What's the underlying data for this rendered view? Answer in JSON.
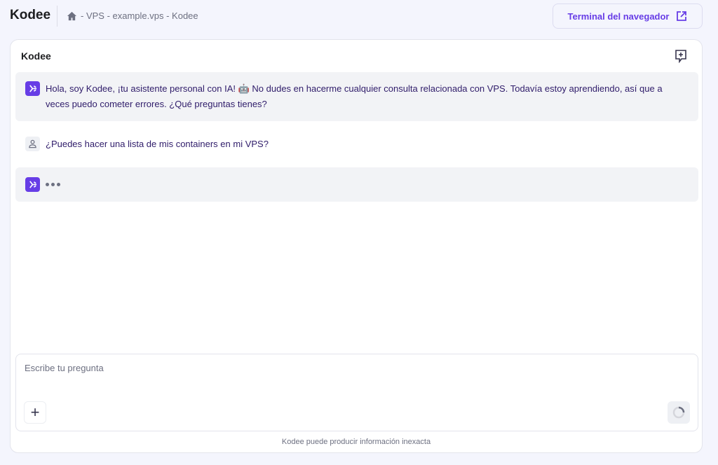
{
  "header": {
    "title": "Kodee",
    "breadcrumb": "- VPS - example.vps - Kodee",
    "terminal_button": "Terminal del navegador"
  },
  "chat": {
    "title": "Kodee",
    "messages": [
      {
        "role": "bot",
        "text": "Hola, soy Kodee, ¡tu asistente personal con IA! 🤖 No dudes en hacerme cualquier consulta relacionada con VPS. Todavía estoy aprendiendo, así que a veces puedo cometer errores. ¿Qué preguntas tienes?"
      },
      {
        "role": "user",
        "text": "¿Puedes hacer una lista de mis containers en mi VPS?"
      }
    ],
    "input_placeholder": "Escribe tu pregunta",
    "disclaimer": "Kodee puede producir información inexacta"
  },
  "colors": {
    "accent": "#673de6",
    "background": "#f4f5fd"
  }
}
